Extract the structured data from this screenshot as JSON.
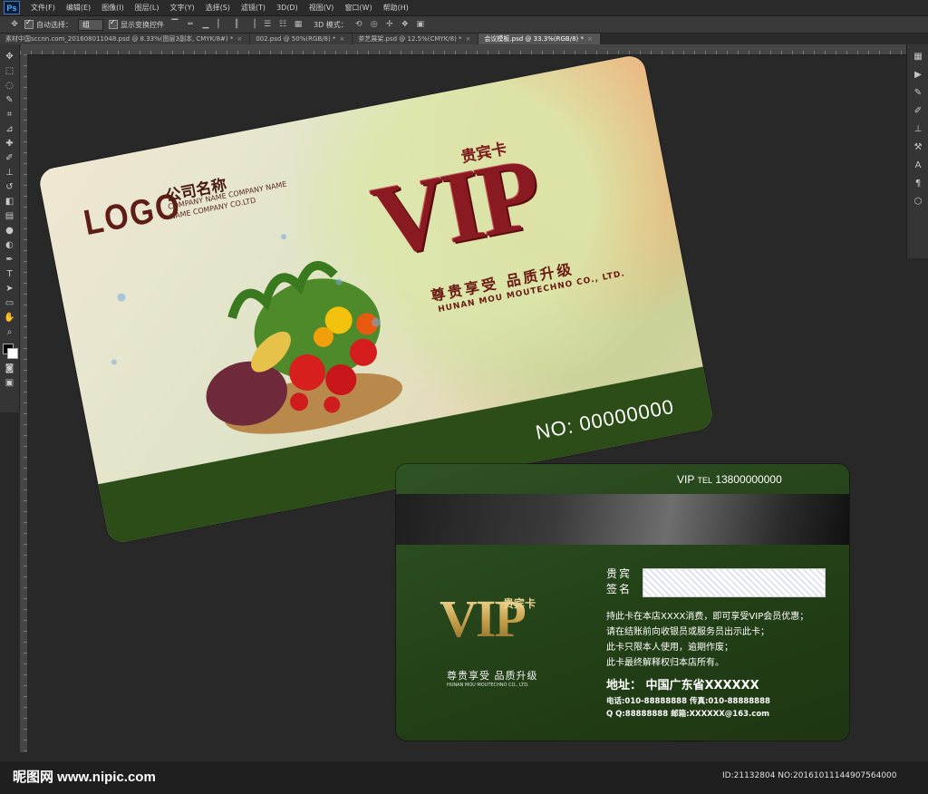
{
  "app": {
    "logo_text": "Ps",
    "menu": [
      "文件(F)",
      "编辑(E)",
      "图像(I)",
      "图层(L)",
      "文字(Y)",
      "选择(S)",
      "滤镜(T)",
      "3D(D)",
      "视图(V)",
      "窗口(W)",
      "帮助(H)"
    ]
  },
  "options_bar": {
    "auto_select_label": "自动选择：",
    "auto_select_value": "组",
    "show_transform_label": "显示变换控件",
    "mode_label": "3D 模式："
  },
  "tabs": [
    {
      "label": "素材中国sccnn.com_20160801104​8.psd @ 8.33%(图层3副本, CMYK/8#) *",
      "active": false
    },
    {
      "label": "002.psd @ 50%(RGB/8) *",
      "active": false
    },
    {
      "label": "茶艺展架.psd @ 12.5%(CMYK/8) *",
      "active": false
    },
    {
      "label": "会议模板.psd @ 33.3%(RGB/8) *",
      "active": true
    }
  ],
  "front_card": {
    "logo": "LOGO",
    "company_name": "公司名称",
    "company_en_1": "COMPANY NAME COMPANY NAME",
    "company_en_2": "NAME COMPANY CO.LTD",
    "vip": "VIP",
    "vip_sub": "贵宾卡",
    "slogan": "尊贵享受  品质升级",
    "slogan_en": "HUNAN MOU MOUTECHNO CO., LTD.",
    "card_no": "NO:  00000000",
    "colors": {
      "accent": "#8a1a22",
      "band": "#2d4d18"
    }
  },
  "back_card": {
    "tel_prefix": "VIP",
    "tel_label": "TEL",
    "tel_number": "13800000000",
    "sign_label_1": "贵宾",
    "sign_label_2": "签名",
    "vip": "VIP",
    "vip_sub": "贵宾卡",
    "slogan": "尊贵享受  品质升级",
    "slogan_en": "HUNAN MOU MOUTECHNO CO., LTD.",
    "terms": [
      "持此卡在本店XXXX消费，即可享受VIP会员优惠；",
      "请在结账前向收银员或服务员出示此卡；",
      "此卡只限本人使用，逾期作废；",
      "此卡最终解释权归本店所有。"
    ],
    "address": "地址：  中国广东省XXXXXX",
    "contact_1": "电话:010-88888888  传真:010-88888888",
    "contact_2": "Q Q:88888888  邮箱:XXXXXX@163.com",
    "colors": {
      "background": "#223f16",
      "gold": "#d6b46a"
    }
  },
  "watermark": {
    "left": "昵图网 www.nipic.com",
    "right": "ID:21132804 NO:20161011144907564000"
  }
}
